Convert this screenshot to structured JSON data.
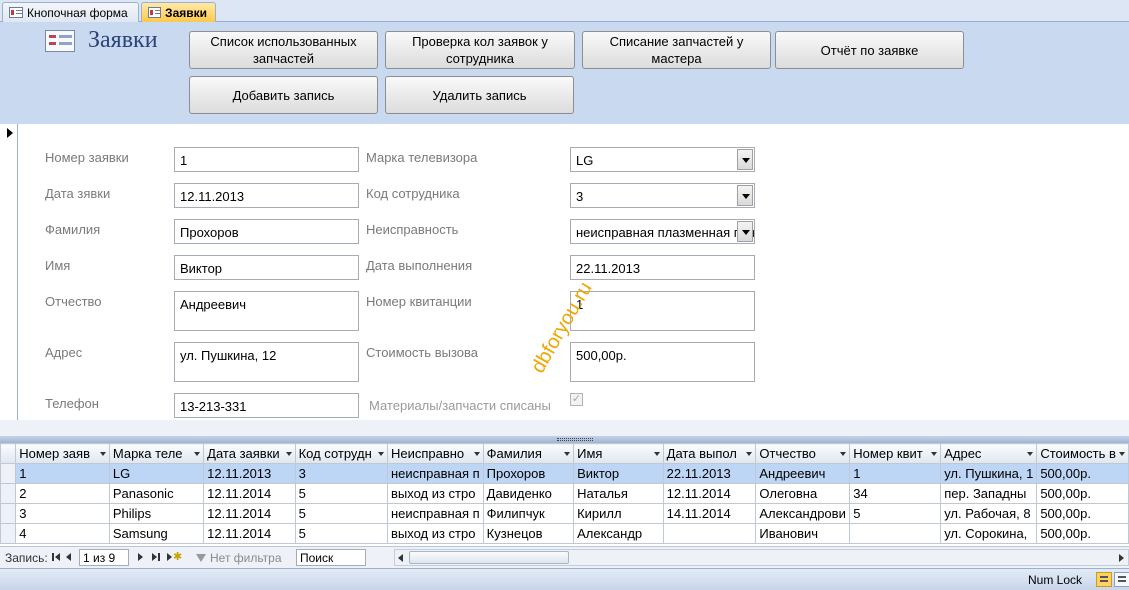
{
  "tabs": [
    {
      "label": "Кнопочная форма",
      "active": false
    },
    {
      "label": "Заявки",
      "active": true
    }
  ],
  "header": {
    "title": "Заявки",
    "buttons": {
      "used_parts": "Список использованных запчастей",
      "check_count": "Проверка кол заявок у сотрудника",
      "writeoff": "Списание запчастей у мастера",
      "report": "Отчёт по заявке",
      "add": "Добавить запись",
      "delete": "Удалить запись"
    }
  },
  "form": {
    "labels": {
      "order_no": "Номер заявки",
      "order_date": "Дата зявки",
      "last_name": "Фамилия",
      "first_name": "Имя",
      "patronymic": "Отчество",
      "address": "Адрес",
      "phone": "Телефон",
      "tv_brand": "Марка телевизора",
      "employee_code": "Код сотрудника",
      "fault": "Неисправность",
      "done_date": "Дата выполнения",
      "receipt_no": "Номер квитанции",
      "call_cost": "Стоимость вызова",
      "parts_written_off": "Материалы/запчасти списаны"
    },
    "values": {
      "order_no": "1",
      "order_date": "12.11.2013",
      "last_name": "Прохоров",
      "first_name": "Виктор",
      "patronymic": "Андреевич",
      "address": "ул. Пушкина, 12",
      "phone": "13-213-331",
      "tv_brand": "LG",
      "employee_code": "3",
      "fault": "неисправная плазменная панель",
      "done_date": "22.11.2013",
      "receipt_no": "1",
      "call_cost": "500,00р.",
      "parts_written_off": true
    },
    "watermark": "dbforyou.ru"
  },
  "grid": {
    "columns": [
      "Номер заяв",
      "Марка теле",
      "Дата заявки",
      "Код сотрудн",
      "Неисправно",
      "Фамилия",
      "Имя",
      "Дата выпол",
      "Отчество",
      "Номер квит",
      "Адрес",
      "Стоимость в"
    ],
    "rows": [
      [
        "1",
        "LG",
        "12.11.2013",
        "3",
        "неисправная п",
        "Прохоров",
        "Виктор",
        "22.11.2013",
        "Андреевич",
        "1",
        "ул. Пушкина, 1",
        "500,00р."
      ],
      [
        "2",
        "Panasonic",
        "12.11.2014",
        "5",
        "выход из стро",
        "Давиденко",
        "Наталья",
        "12.11.2014",
        "Олеговна",
        "34",
        "пер. Западны",
        "500,00р."
      ],
      [
        "3",
        "Philips",
        "12.11.2014",
        "5",
        "неисправная п",
        "Филипчук",
        "Кирилл",
        "14.11.2014",
        "Александрови",
        "5",
        "ул. Рабочая, 8",
        "500,00р."
      ],
      [
        "4",
        "Samsung",
        "12.11.2014",
        "5",
        "выход из стро",
        "Кузнецов",
        "Александр",
        "",
        "Иванович",
        "",
        "ул. Сорокина,",
        "500,00р."
      ]
    ]
  },
  "navbar": {
    "label": "Запись:",
    "record_position": "1 из 9",
    "filter": "Нет фильтра",
    "search_placeholder": "Поиск"
  },
  "statusbar": {
    "numlock": "Num Lock"
  }
}
